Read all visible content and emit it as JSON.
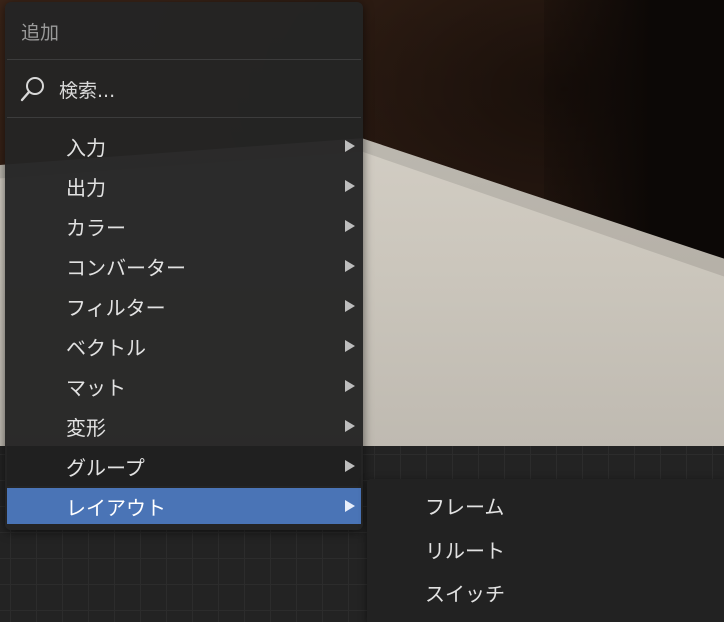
{
  "menu": {
    "title": "追加",
    "search_label": "検索...",
    "items": [
      {
        "label": "入力"
      },
      {
        "label": "出力"
      },
      {
        "label": "カラー"
      },
      {
        "label": "コンバーター"
      },
      {
        "label": "フィルター"
      },
      {
        "label": "ベクトル"
      },
      {
        "label": "マット"
      },
      {
        "label": "変形"
      },
      {
        "label": "グループ"
      },
      {
        "label": "レイアウト"
      }
    ],
    "active_item": "レイアウト",
    "accent_color": "#4a74b6"
  },
  "submenu": {
    "items": [
      {
        "label": "フレーム"
      },
      {
        "label": "リルート"
      },
      {
        "label": "スイッチ"
      }
    ]
  },
  "icons": {
    "search": "search-icon",
    "arrow": "chevron-right-icon"
  }
}
